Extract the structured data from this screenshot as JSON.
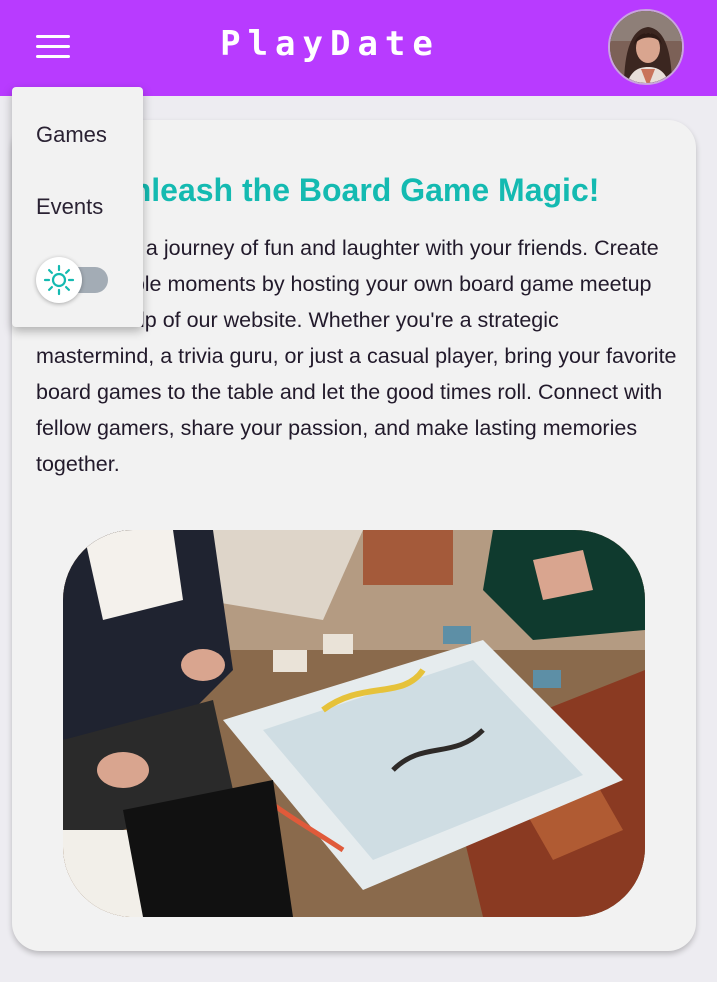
{
  "header": {
    "brand": "PlayDate",
    "menu_icon": "hamburger-menu-icon",
    "avatar_icon": "user-avatar",
    "background_color": "#b83bff"
  },
  "menu": {
    "items": [
      {
        "label": "Games"
      },
      {
        "label": "Events"
      }
    ],
    "theme_toggle": {
      "icon": "sun-icon",
      "mode": "light",
      "accent_color": "#14bab1"
    }
  },
  "card": {
    "title": "Unleash the Board Game Magic!",
    "text": "Embark on a journey of fun and laughter with your friends. Create unforgettable moments by hosting your own board game meetup with the help of our website. Whether you're a strategic mastermind, a trivia guru, or just a casual player, bring your favorite board games to the table and let the good times roll. Connect with fellow gamers, share your passion, and make lasting memories together.",
    "title_color": "#14bab1"
  }
}
